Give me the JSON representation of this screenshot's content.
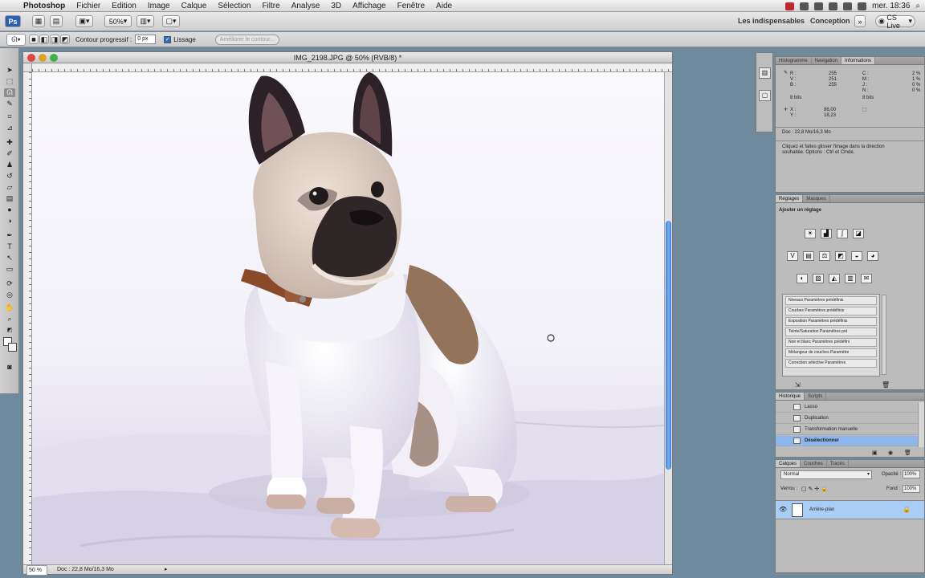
{
  "menubar": {
    "app": "Photoshop",
    "items": [
      "Fichier",
      "Edition",
      "Image",
      "Calque",
      "Sélection",
      "Filtre",
      "Analyse",
      "3D",
      "Affichage",
      "Fenêtre",
      "Aide"
    ],
    "clock": "mer. 18:36"
  },
  "appbar": {
    "zoom": "50%",
    "workspace1": "Les indispensables",
    "workspace2": "Conception",
    "cslive": "CS Live"
  },
  "options": {
    "contour_label": "Contour progressif :",
    "contour_value": "0 px",
    "lissage_label": "Lissage",
    "refine_label": "Améliorer le contour..."
  },
  "document": {
    "title": "IMG_2198.JPG @ 50% (RVB/8) *",
    "status_zoom": "50 %",
    "status_doc": "Doc : 22,8 Mo/16,3 Mo"
  },
  "info_panel": {
    "tabs": [
      "Histogramme",
      "Navigation",
      "Informations"
    ],
    "active_tab": "Informations",
    "doc": "Doc : 22,8 Mo/16,3 Mo",
    "help": "Cliquez et faites glisser l'image dans la direction souhaitée. Options : Ctrl et Cmde.",
    "rgb_labels": [
      "R :",
      "V :",
      "B :"
    ],
    "rgb_values": [
      "255",
      "251",
      "255"
    ],
    "cmjn_labels": [
      "C :",
      "M :",
      "J :",
      "N :"
    ],
    "cmjn_values": [
      "2 %",
      "1 %",
      "0 %",
      "0 %"
    ],
    "bits": "8 bits",
    "x_label": "X :",
    "x_value": "86,00",
    "y_label": "Y :",
    "y_value": "18,23"
  },
  "adjust_panel": {
    "tabs": [
      "Réglages",
      "Masques"
    ],
    "active_tab": "Réglages",
    "heading": "Ajouter un réglage",
    "presets": [
      "Niveaux Paramètres prédéfinis",
      "Courbes Paramètres prédéfinis",
      "Exposition Paramètres prédéfinis",
      "Teinte/Saturation Paramètres pré",
      "Noir et blanc Paramètres prédéfini",
      "Mélangeur de couches Paramètre",
      "Correction sélective Paramètres"
    ]
  },
  "history_panel": {
    "tabs": [
      "Historique",
      "Scripts"
    ],
    "active_tab": "Historique",
    "items": [
      "Lasso",
      "Duplication",
      "Transformation manuelle",
      "Désélectionner"
    ],
    "selected": "Désélectionner"
  },
  "layers_panel": {
    "tabs": [
      "Calques",
      "Couches",
      "Tracés"
    ],
    "active_tab": "Calques",
    "blend_mode": "Normal",
    "opacity_label": "Opacité :",
    "opacity": "100%",
    "fill_label": "Fond :",
    "fill": "100%",
    "lock_label": "Verrou :",
    "layers": [
      "Arrière-plan"
    ]
  }
}
